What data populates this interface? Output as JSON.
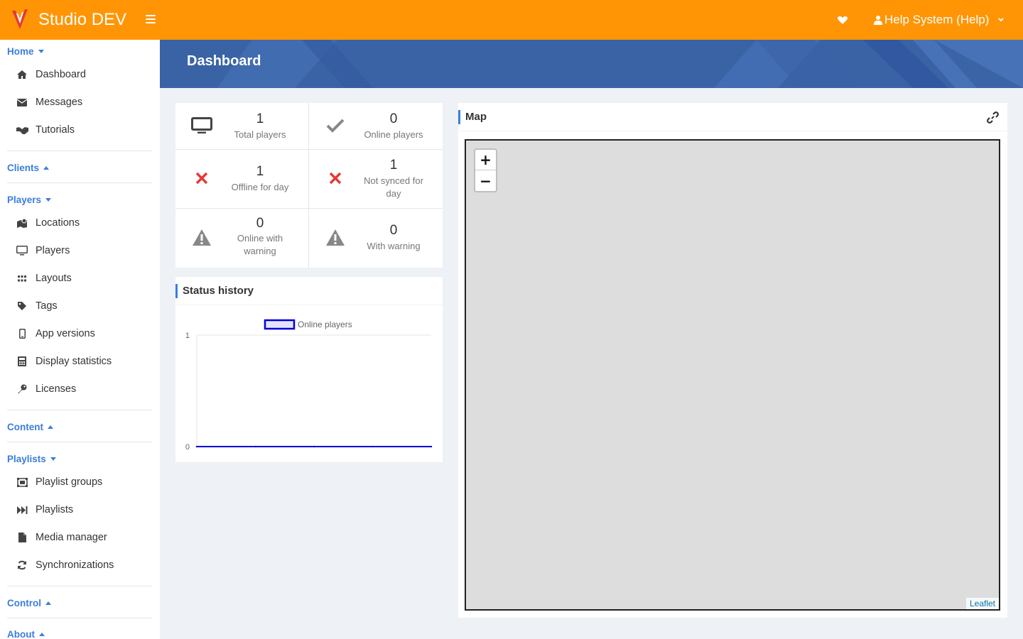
{
  "app": {
    "title": "Studio DEV",
    "user_label": "Help System (Help)",
    "brand_color": "#ff9505",
    "accent_color": "#3b7ddd"
  },
  "page": {
    "title": "Dashboard"
  },
  "sidebar": {
    "sections": [
      {
        "label": "Home",
        "state": "expanded",
        "items": [
          {
            "label": "Dashboard",
            "icon": "home-icon"
          },
          {
            "label": "Messages",
            "icon": "envelope-icon"
          },
          {
            "label": "Tutorials",
            "icon": "handshake-icon"
          }
        ]
      },
      {
        "label": "Clients",
        "state": "collapsed",
        "items": []
      },
      {
        "label": "Players",
        "state": "expanded",
        "items": [
          {
            "label": "Locations",
            "icon": "map-marker-icon"
          },
          {
            "label": "Players",
            "icon": "monitor-icon"
          },
          {
            "label": "Layouts",
            "icon": "grid-icon"
          },
          {
            "label": "Tags",
            "icon": "tag-icon"
          },
          {
            "label": "App versions",
            "icon": "mobile-icon"
          },
          {
            "label": "Display statistics",
            "icon": "calculator-icon"
          },
          {
            "label": "Licenses",
            "icon": "key-icon"
          }
        ]
      },
      {
        "label": "Content",
        "state": "collapsed",
        "items": []
      },
      {
        "label": "Playlists",
        "state": "expanded",
        "items": [
          {
            "label": "Playlist groups",
            "icon": "object-group-icon"
          },
          {
            "label": "Playlists",
            "icon": "fast-forward-icon"
          },
          {
            "label": "Media manager",
            "icon": "file-icon"
          },
          {
            "label": "Synchronizations",
            "icon": "sync-icon"
          }
        ]
      },
      {
        "label": "Control",
        "state": "collapsed",
        "items": []
      },
      {
        "label": "About",
        "state": "collapsed",
        "items": []
      }
    ]
  },
  "stats": [
    {
      "value": "1",
      "label": "Total players",
      "icon": "monitor-icon"
    },
    {
      "value": "0",
      "label": "Online players",
      "icon": "check-icon"
    },
    {
      "value": "1",
      "label": "Offline for day",
      "icon": "x-icon"
    },
    {
      "value": "1",
      "label": "Not synced for day",
      "icon": "x-icon"
    },
    {
      "value": "0",
      "label": "Online with warning",
      "icon": "warning-icon"
    },
    {
      "value": "0",
      "label": "With warning",
      "icon": "warning-icon"
    }
  ],
  "status_history": {
    "title": "Status history"
  },
  "chart_data": {
    "type": "line",
    "title": "",
    "xlabel": "",
    "ylabel": "",
    "ylim": [
      0,
      1
    ],
    "yticks": [
      "0",
      "1"
    ],
    "legend_position": "top",
    "series": [
      {
        "name": "Online players",
        "color": "#0000dd",
        "values": [
          0,
          0,
          0,
          0,
          0
        ]
      }
    ]
  },
  "map": {
    "title": "Map",
    "zoom_in": "+",
    "zoom_out": "−",
    "attribution": "Leaflet"
  }
}
